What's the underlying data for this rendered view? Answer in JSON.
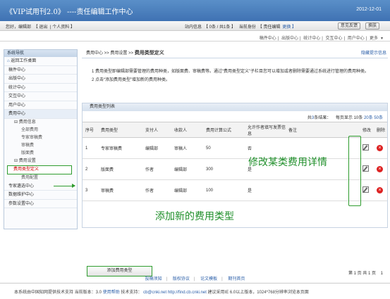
{
  "header": {
    "title": "《VIP试用刊2.0》 ----责任编辑工作中心",
    "date": "2012-12-01"
  },
  "userbar": {
    "greeting": "您好，编辑部",
    "logout": "【 退出",
    "profile": "| 个人资料 】",
    "inbox_prefix": "站内信息",
    "inbox_count": "【 0条 / 共1条 】",
    "role_prefix": "当前身份",
    "role": "【 责任编辑",
    "role_switch": "更换 】",
    "feedback_button": "意见反馈",
    "skin_button": "换肤"
  },
  "module_nav": [
    "稿件中心",
    "出版中心",
    "统计中心",
    "交互中心",
    "用户中心",
    "更多"
  ],
  "sidebar": {
    "title": "系统导航",
    "home": "返回工作桌面",
    "top_items": [
      "稿件中心",
      "出版中心",
      "统计中心",
      "交互中心",
      "用户中心",
      "费用中心"
    ],
    "fee_info": "费用信息",
    "fee_info_items": [
      "全部费用",
      "专家审稿费",
      "审稿费",
      "版面费"
    ],
    "fee_settings": "费用设置",
    "fee_type_def": "费用类型定义",
    "fee_config": "费用配置",
    "bottom_items": [
      "专家遴选中心",
      "数据维护中心",
      "参数设置中心"
    ]
  },
  "main": {
    "breadcrumb_prefix": "费用中心 >> 费用设置 >>",
    "breadcrumb_current": "费用类型定义",
    "hide_tips": "隐藏提示信息",
    "tip1": "1 费用类型即编辑部需要管理的费用种类，如版面费、审稿费等。通过“费用类型定义”子栏目您可以增加或者删除需要通过系统进行管理的费用种类。",
    "tip2": "2 点击“添加费用类型”增加新的费用种类。",
    "panel_title": "费用类型列表",
    "count_prefix": "共",
    "count_value": "3",
    "count_suffix": "条结果：",
    "per_page_prefix": "每页显示",
    "per_page_options": [
      "10条",
      "20条",
      "50条"
    ],
    "columns": [
      "序号",
      "费用类型",
      "支付人",
      "收款人",
      "费用计算公式",
      "允许作者填写发票信息",
      "备注",
      "修改",
      "删除"
    ],
    "rows": [
      {
        "no": "1",
        "type": "专家审稿费",
        "payer": "编辑部",
        "payee": "审稿人",
        "formula": "50",
        "invoice": "否",
        "note": ""
      },
      {
        "no": "2",
        "type": "版面费",
        "payer": "作者",
        "payee": "编辑部",
        "formula": "300",
        "invoice": "是",
        "note": ""
      },
      {
        "no": "3",
        "type": "审稿费",
        "payer": "作者",
        "payee": "编辑部",
        "formula": "100",
        "invoice": "是",
        "note": ""
      }
    ],
    "add_button": "添加费用类型",
    "pager": "第 1 页 共 1 页",
    "page_number": "1"
  },
  "annotations": {
    "edit": "修改某类费用详情",
    "add": "添加新的费用类型"
  },
  "footer": {
    "links": [
      "投稿须知",
      "版权协议",
      "论文模板",
      "期刊首页"
    ],
    "support": "本系统由中国知网提供技术支持  当前版本：3.0",
    "help": "使用帮助",
    "tech_label": "技术支持：",
    "email": "cb@cnki.net",
    "url": "http://find.cb.cnki.net",
    "browser_note": "建议采用IE 6.0以上版本，1024*768分辨率浏览本页面"
  }
}
